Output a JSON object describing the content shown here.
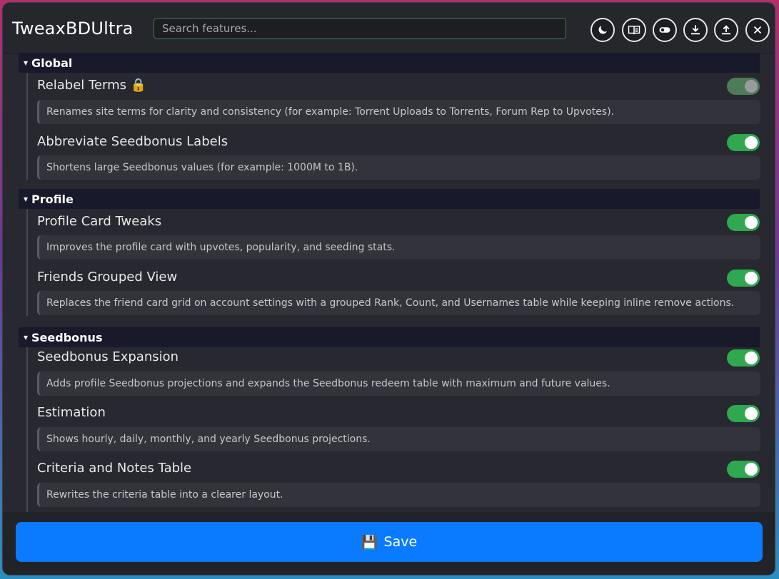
{
  "app": {
    "title": "TweaxBDUltra"
  },
  "search": {
    "placeholder": "Search features..."
  },
  "header_buttons": [
    {
      "icon": "moon-icon"
    },
    {
      "icon": "book-icon"
    },
    {
      "icon": "toggle-icon"
    },
    {
      "icon": "download-icon"
    },
    {
      "icon": "upload-icon"
    },
    {
      "icon": "close-icon"
    }
  ],
  "sections": {
    "global": {
      "title": "Global",
      "caret": "▾",
      "items": [
        {
          "label": "Relabel Terms",
          "lock_icon": "🔒",
          "enabled": true,
          "locked": true,
          "description": "Renames site terms for clarity and consistency (for example: Torrent Uploads to Torrents, Forum Rep to Upvotes)."
        },
        {
          "label": "Abbreviate Seedbonus Labels",
          "enabled": true,
          "description": "Shortens large Seedbonus values (for example: 1000M to 1B)."
        }
      ]
    },
    "profile": {
      "title": "Profile",
      "caret": "▾",
      "items": [
        {
          "label": "Profile Card Tweaks",
          "enabled": true,
          "description": "Improves the profile card with upvotes, popularity, and seeding stats."
        },
        {
          "label": "Friends Grouped View",
          "enabled": true,
          "description": "Replaces the friend card grid on account settings with a grouped Rank, Count, and Usernames table while keeping inline remove actions."
        }
      ]
    },
    "seedbonus": {
      "title": "Seedbonus",
      "caret": "▾",
      "items": [
        {
          "label": "Seedbonus Expansion",
          "enabled": true,
          "description": "Adds profile Seedbonus projections and expands the Seedbonus redeem table with maximum and future values."
        },
        {
          "label": "Estimation",
          "enabled": true,
          "description": "Shows hourly, daily, monthly, and yearly Seedbonus projections."
        },
        {
          "label": "Criteria and Notes Table",
          "enabled": true,
          "description": "Rewrites the criteria table into a clearer layout."
        }
      ]
    }
  },
  "footer": {
    "save_label": "Save",
    "save_icon": "💾"
  },
  "colors": {
    "accent": "#0a7bff",
    "toggle_on": "#2fa84f",
    "section_bg": "#18192a",
    "search_border": "#3d7a55"
  }
}
